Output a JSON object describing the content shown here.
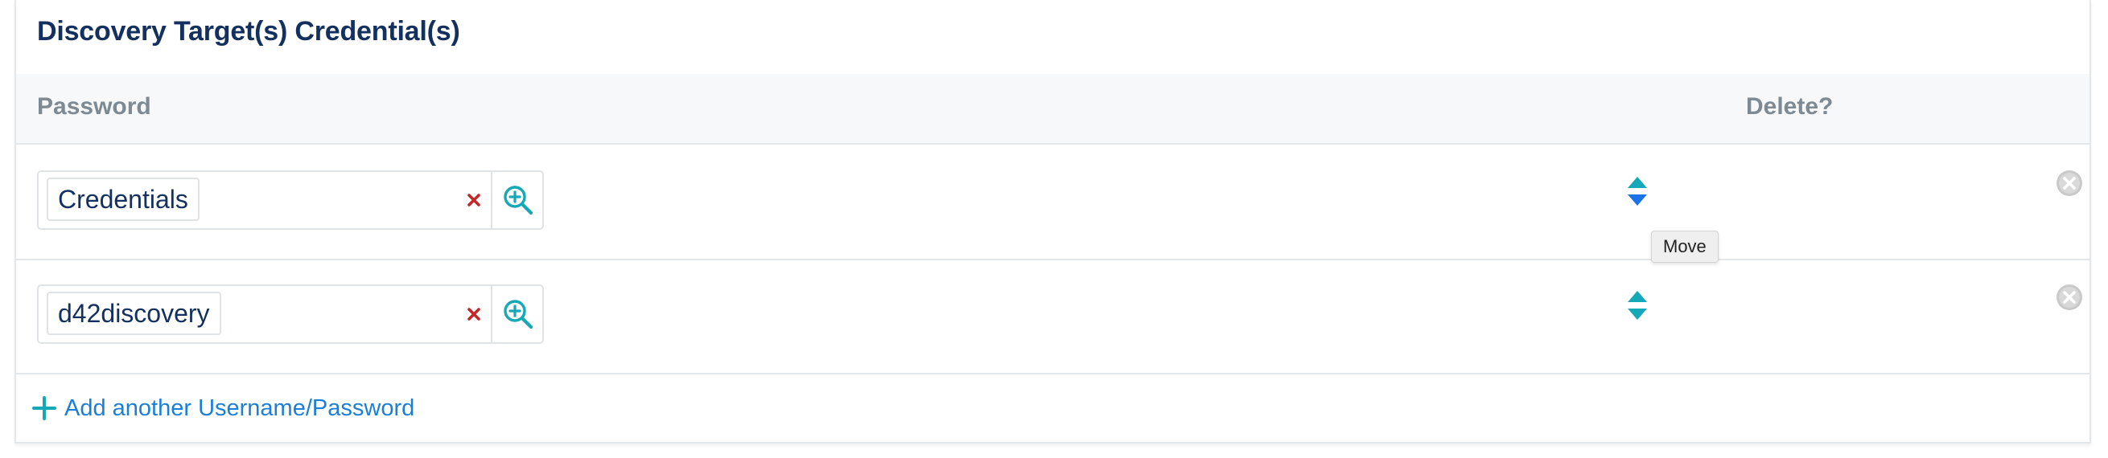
{
  "panel": {
    "title": "Discovery Target(s) Credential(s)"
  },
  "table": {
    "columns": [
      "Password",
      "Delete?"
    ]
  },
  "rows": [
    {
      "credential": "Credentials"
    },
    {
      "credential": "d42discovery"
    }
  ],
  "tooltip": {
    "text": "Move"
  },
  "add_link": {
    "label": "Add another Username/Password"
  },
  "icons": {
    "clear": "close-x-icon",
    "search": "zoom-in-icon",
    "move": "move-handle-icon",
    "delete": "circle-x-icon",
    "add": "plus-icon"
  },
  "colors": {
    "title": "#14305f",
    "header_text": "#7d8a93",
    "link": "#1a7fd8",
    "clear_x": "#c62828",
    "search_icon": "#14a8b8",
    "move_hover": "#1a73e8",
    "move_default": "#14a8b8",
    "delete_icon": "#c9c9c9"
  }
}
